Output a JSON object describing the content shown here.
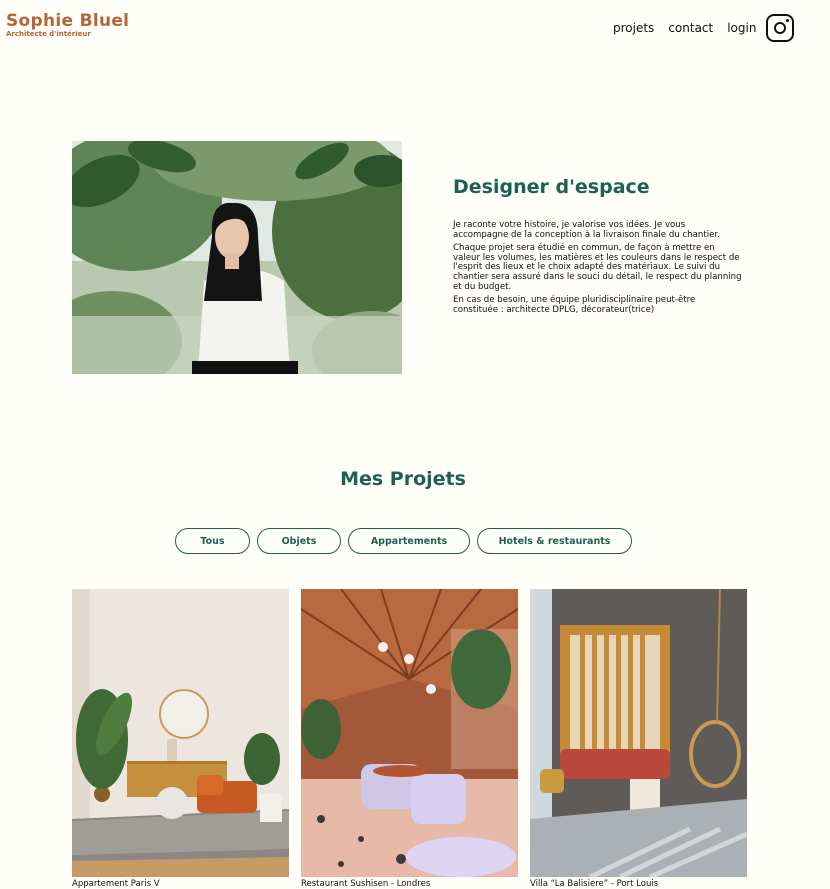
{
  "header": {
    "logo_title": "Sophie Bluel",
    "logo_subtitle": "Architecte d'intérieur",
    "nav": [
      "projets",
      "contact",
      "login"
    ]
  },
  "intro": {
    "title": "Designer d'espace",
    "paragraphs": [
      "Je raconte votre histoire, je valorise vos idées. Je vous accompagne de la conception à la livraison finale du chantier.",
      "Chaque projet sera étudié en commun, de façon à mettre en valeur les volumes, les matières et les couleurs dans le respect de l'esprit des lieux et le choix adapté des matériaux. Le suivi du chantier sera assuré dans le souci du détail, le respect du planning et du budget.",
      "En cas de besoin, une équipe pluridisciplinaire peut-être constituée : architecte DPLG, décorateur(trice)"
    ]
  },
  "projects": {
    "title": "Mes Projets",
    "filters": [
      "Tous",
      "Objets",
      "Appartements",
      "Hotels & restaurants"
    ],
    "items": [
      {
        "caption": "Appartement Paris V"
      },
      {
        "caption": "Restaurant Sushisen - Londres"
      },
      {
        "caption": "Villa “La Balisiere” - Port Louis"
      }
    ]
  },
  "colors": {
    "brand": "#b1663c",
    "accent": "#1d6154",
    "background": "#fffef8"
  },
  "icons": [
    "instagram-icon"
  ]
}
